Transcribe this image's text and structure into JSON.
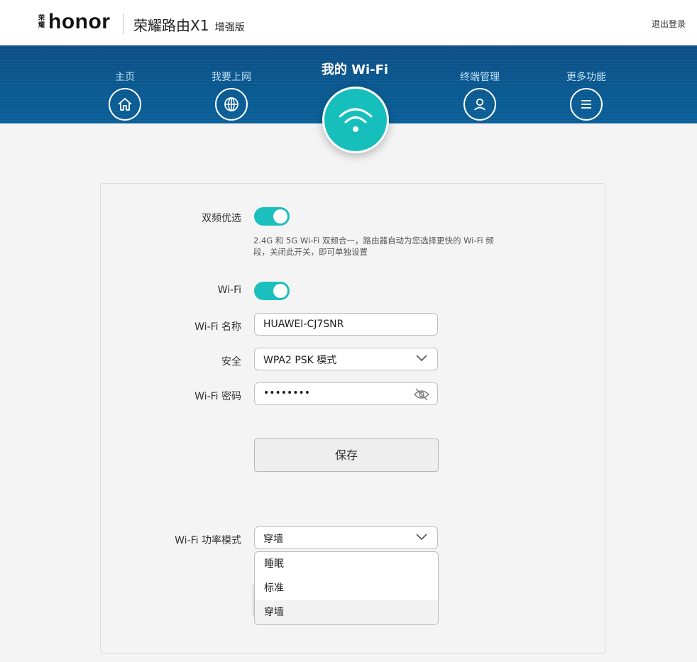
{
  "header": {
    "logo_cn": "荣耀",
    "logo_en": "honor",
    "product_name": "荣耀路由X1",
    "product_edition": "增强版",
    "logout_label": "退出登录"
  },
  "nav": {
    "items": [
      {
        "label": "主页",
        "icon": "home-icon"
      },
      {
        "label": "我要上网",
        "icon": "globe-icon"
      },
      {
        "label": "我的 Wi-Fi",
        "icon": "wifi-icon",
        "active": true
      },
      {
        "label": "终端管理",
        "icon": "user-icon"
      },
      {
        "label": "更多功能",
        "icon": "menu-icon"
      }
    ],
    "active_color": "#16bfbc",
    "band_color": "#0a5a92"
  },
  "form": {
    "dual_band_label": "双频优选",
    "dual_band_on": true,
    "dual_band_hint": "2.4G 和 5G Wi-Fi 双频合一，路由器自动为您选择更快的 Wi-Fi 频段，关闭此开关，即可单独设置",
    "wifi_label": "Wi-Fi",
    "wifi_on": true,
    "ssid_label": "Wi-Fi 名称",
    "ssid_value": "HUAWEI-CJ7SNR",
    "security_label": "安全",
    "security_value": "WPA2 PSK 模式",
    "password_label": "Wi-Fi 密码",
    "password_value": "••••••••",
    "save_label": "保存",
    "power_mode_label": "Wi-Fi 功率模式",
    "power_mode_value": "穿墙",
    "power_mode_options": [
      "睡眠",
      "标准",
      "穿墙"
    ],
    "toggle_color": "#1bbfbd"
  }
}
